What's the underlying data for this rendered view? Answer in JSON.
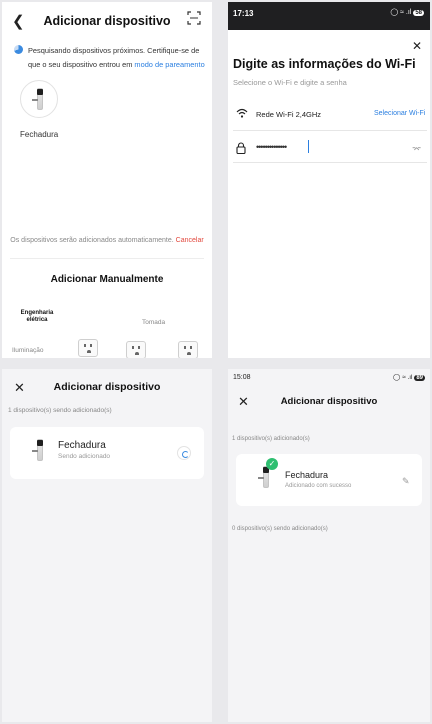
{
  "screen1": {
    "back_icon": "chevron-left-icon",
    "title": "Adicionar dispositivo",
    "scan_icon": "scan-icon",
    "info_prefix": "Pesquisando dispositivos próximos. Certifique-se de que o seu dispositivo entrou em ",
    "info_link": "modo de pareamento",
    "device_label": "Fechadura",
    "auto_text": "Os dispositivos serão adicionados automaticamente.",
    "cancel_label": "Cancelar",
    "manual_label": "Adicionar Manualmente",
    "categories": [
      "Engenharia elétrica",
      "Tomada",
      "Iluminação"
    ]
  },
  "screen2": {
    "time": "17:13",
    "battery": "58",
    "close_icon": "close-icon",
    "heading": "Digite as informações do Wi-Fi",
    "subtitle": "Selecione o Wi-Fi e digite a senha",
    "wifi_name": "Rede Wi-Fi 2,4GHz",
    "select_wifi_label": "Selecionar Wi-Fi",
    "password_value": "••••••••••••••"
  },
  "screen3": {
    "title": "Adicionar dispositivo",
    "count_text": "1 dispositivo(s) sendo adicionado(s)",
    "device_name": "Fechadura",
    "device_status": "Sendo adicionado"
  },
  "screen4": {
    "time": "15:08",
    "battery": "89",
    "title": "Adicionar dispositivo",
    "count_added": "1 dispositivo(s) adicionado(s)",
    "device_name": "Fechadura",
    "device_status": "Adicionado com sucesso",
    "count_adding": "0 dispositivo(s) sendo adicionado(s)"
  },
  "colors": {
    "accent": "#2b7fe0",
    "cancel": "#e2483d",
    "success": "#2fbf71"
  }
}
